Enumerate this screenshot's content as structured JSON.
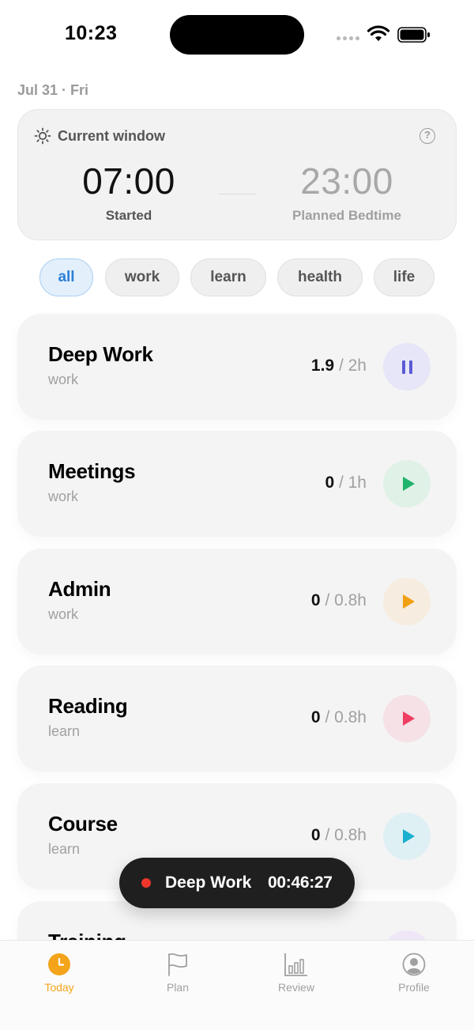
{
  "status_bar": {
    "time": "10:23"
  },
  "date": "Jul 31 · Fri",
  "current_window": {
    "title": "Current window",
    "help_symbol": "?",
    "start_time": "07:00",
    "start_label": "Started",
    "end_time": "23:00",
    "end_label": "Planned Bedtime"
  },
  "filters": {
    "items": [
      "all",
      "work",
      "learn",
      "health",
      "life"
    ],
    "selected": "all"
  },
  "activities": [
    {
      "name": "Deep Work",
      "category": "work",
      "done": "1.9",
      "target": " / 2h",
      "state": "running",
      "accent": "#5b5bd6",
      "tint": "#e6e6f8",
      "icon": "pause-icon"
    },
    {
      "name": "Meetings",
      "category": "work",
      "done": "0",
      "target": " / 1h",
      "state": "idle",
      "accent": "#21b36c",
      "tint": "#e0f2e8",
      "icon": "play-icon"
    },
    {
      "name": "Admin",
      "category": "work",
      "done": "0",
      "target": " / 0.8h",
      "state": "idle",
      "accent": "#f1a012",
      "tint": "#f6ecdf",
      "icon": "play-icon"
    },
    {
      "name": "Reading",
      "category": "learn",
      "done": "0",
      "target": " / 0.8h",
      "state": "idle",
      "accent": "#ef3e62",
      "tint": "#f5e1e6",
      "icon": "play-icon"
    },
    {
      "name": "Course",
      "category": "learn",
      "done": "0",
      "target": " / 0.8h",
      "state": "idle",
      "accent": "#1aafcf",
      "tint": "#dff0f4",
      "icon": "play-icon"
    },
    {
      "name": "Training",
      "category": "",
      "done": "",
      "target": "",
      "state": "idle",
      "accent": "#a37ad6",
      "tint": "#efe6f7",
      "icon": "play-icon"
    }
  ],
  "timer": {
    "activity": "Deep Work",
    "elapsed": "00:46:27",
    "status_color": "#f0362b"
  },
  "tabs": [
    {
      "label": "Today",
      "icon": "clock-icon",
      "active": true
    },
    {
      "label": "Plan",
      "icon": "flag-icon",
      "active": false
    },
    {
      "label": "Review",
      "icon": "bar-chart-icon",
      "active": false
    },
    {
      "label": "Profile",
      "icon": "person-icon",
      "active": false
    }
  ],
  "colors": {
    "accent_today": "#f3a41b",
    "chip_active": "#2a7fd6"
  }
}
